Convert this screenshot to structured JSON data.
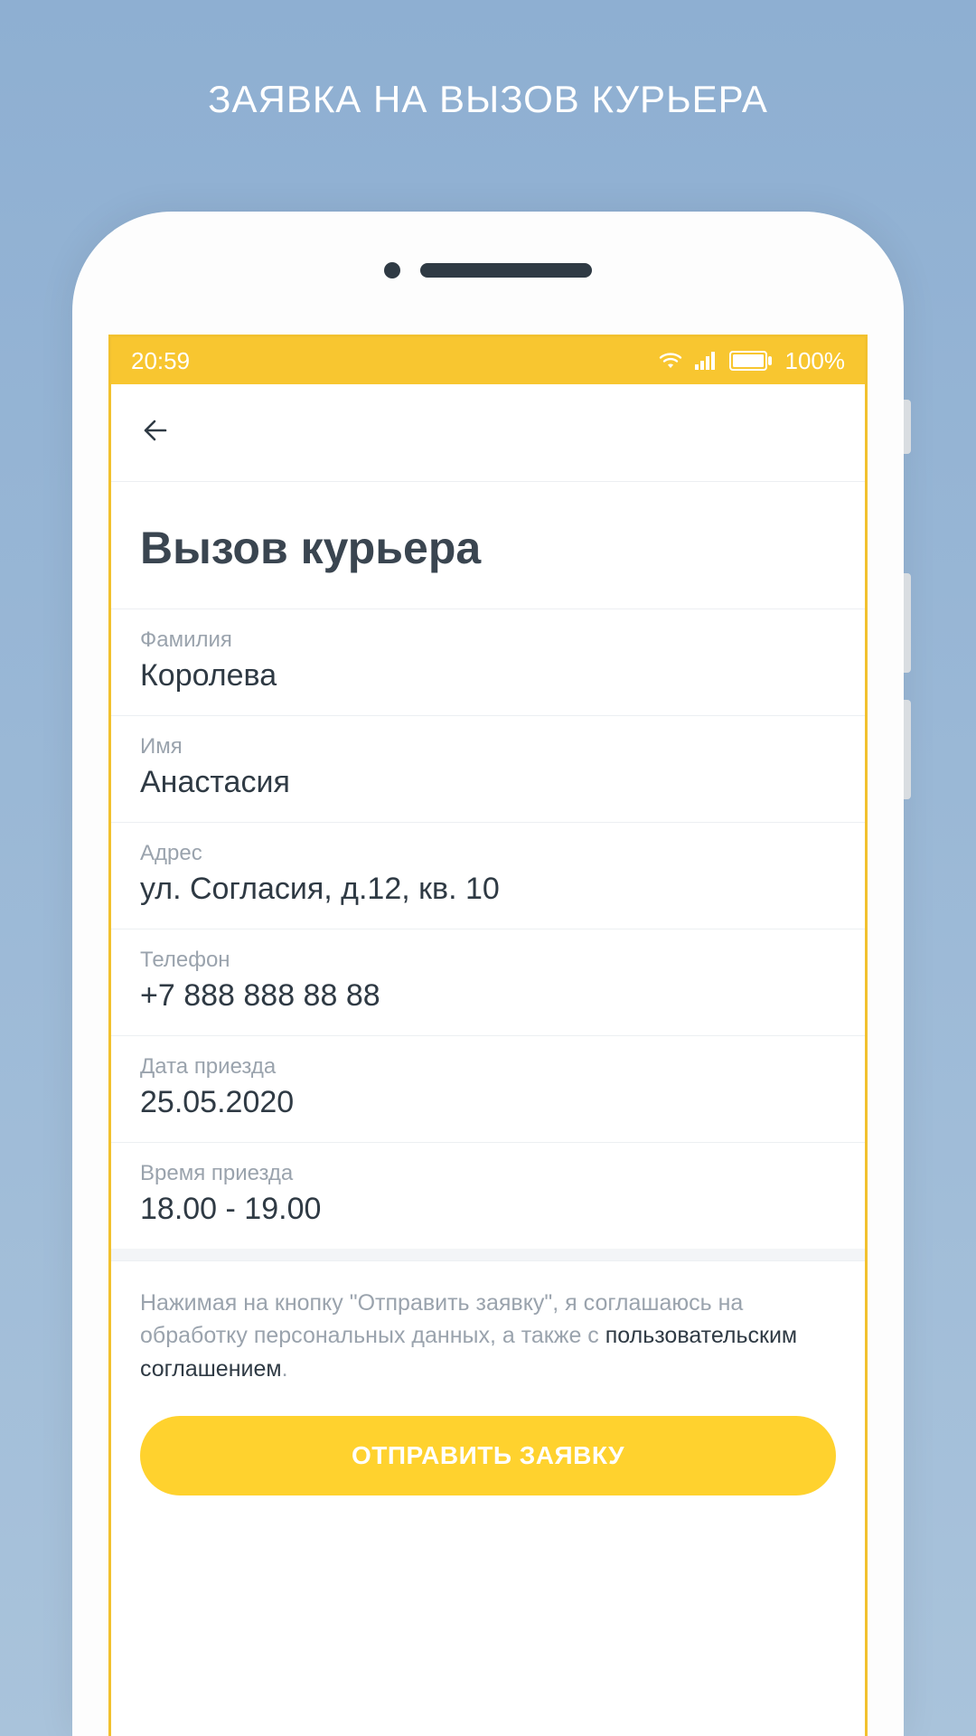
{
  "promo_title": "ЗАЯВКА НА ВЫЗОВ КУРЬЕРА",
  "status": {
    "time": "20:59",
    "battery_pct": "100%"
  },
  "page_title": "Вызов курьера",
  "fields": [
    {
      "label": "Фамилия",
      "value": "Королева"
    },
    {
      "label": "Имя",
      "value": "Анастасия"
    },
    {
      "label": "Адрес",
      "value": "ул. Согласия, д.12, кв. 10"
    },
    {
      "label": "Телефон",
      "value": "+7 888 888 88 88"
    },
    {
      "label": "Дата приезда",
      "value": "25.05.2020"
    },
    {
      "label": "Время приезда",
      "value": "18.00 - 19.00"
    }
  ],
  "consent": {
    "prefix": "Нажимая на кнопку \"Отправить заявку\", я соглашаюсь на обработку персональных данных, а также с ",
    "link": "пользовательским соглашением",
    "suffix": "."
  },
  "submit_label": "ОТПРАВИТЬ ЗАЯВКУ",
  "colors": {
    "accent": "#f8c630",
    "button": "#ffd22e"
  }
}
